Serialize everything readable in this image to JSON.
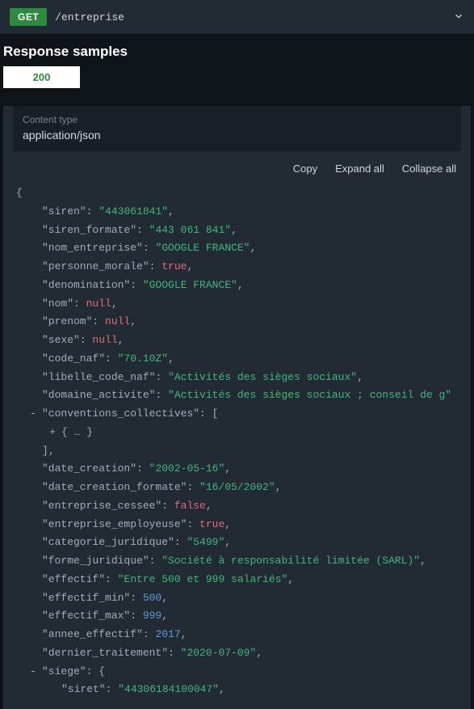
{
  "endpoint": {
    "method": "GET",
    "path": "/entreprise"
  },
  "section_title": "Response samples",
  "status_code": "200",
  "content_type_label": "Content type",
  "content_type_value": "application/json",
  "actions": {
    "copy": "Copy",
    "expand": "Expand all",
    "collapse": "Collapse all"
  },
  "collapsed_placeholder": "{ … }",
  "json_lines": [
    {
      "indent": 0,
      "type": "open",
      "text": "{"
    },
    {
      "indent": 1,
      "type": "kv",
      "key": "siren",
      "vtype": "s",
      "value": "443061841",
      "comma": true
    },
    {
      "indent": 1,
      "type": "kv",
      "key": "siren_formate",
      "vtype": "s",
      "value": "443 061 841",
      "comma": true
    },
    {
      "indent": 1,
      "type": "kv",
      "key": "nom_entreprise",
      "vtype": "s",
      "value": "GOOGLE FRANCE",
      "comma": true
    },
    {
      "indent": 1,
      "type": "kv",
      "key": "personne_morale",
      "vtype": "t",
      "value": "true",
      "comma": true
    },
    {
      "indent": 1,
      "type": "kv",
      "key": "denomination",
      "vtype": "s",
      "value": "GOOGLE FRANCE",
      "comma": true
    },
    {
      "indent": 1,
      "type": "kv",
      "key": "nom",
      "vtype": "nl",
      "value": "null",
      "comma": true
    },
    {
      "indent": 1,
      "type": "kv",
      "key": "prenom",
      "vtype": "nl",
      "value": "null",
      "comma": true
    },
    {
      "indent": 1,
      "type": "kv",
      "key": "sexe",
      "vtype": "nl",
      "value": "null",
      "comma": true
    },
    {
      "indent": 1,
      "type": "kv",
      "key": "code_naf",
      "vtype": "s",
      "value": "70.10Z",
      "comma": true
    },
    {
      "indent": 1,
      "type": "kv",
      "key": "libelle_code_naf",
      "vtype": "s",
      "value": "Activités des sièges sociaux",
      "comma": true
    },
    {
      "indent": 1,
      "type": "kv",
      "key": "domaine_activite",
      "vtype": "s",
      "value": "Activités des sièges sociaux ; conseil de g",
      "comma": false
    },
    {
      "indent": 1,
      "type": "key_open_arr",
      "toggle": "-",
      "key": "conventions_collectives"
    },
    {
      "indent": 2,
      "type": "collapsed",
      "toggle": "+"
    },
    {
      "indent": 1,
      "type": "close_arr",
      "comma": true
    },
    {
      "indent": 1,
      "type": "kv",
      "key": "date_creation",
      "vtype": "s",
      "value": "2002-05-16",
      "comma": true
    },
    {
      "indent": 1,
      "type": "kv",
      "key": "date_creation_formate",
      "vtype": "s",
      "value": "16/05/2002",
      "comma": true
    },
    {
      "indent": 1,
      "type": "kv",
      "key": "entreprise_cessee",
      "vtype": "f",
      "value": "false",
      "comma": true
    },
    {
      "indent": 1,
      "type": "kv",
      "key": "entreprise_employeuse",
      "vtype": "t",
      "value": "true",
      "comma": true
    },
    {
      "indent": 1,
      "type": "kv",
      "key": "categorie_juridique",
      "vtype": "s",
      "value": "5499",
      "comma": true
    },
    {
      "indent": 1,
      "type": "kv",
      "key": "forme_juridique",
      "vtype": "s",
      "value": "Société à responsabilité limitée (SARL)",
      "comma": true
    },
    {
      "indent": 1,
      "type": "kv",
      "key": "effectif",
      "vtype": "s",
      "value": "Entre 500 et 999 salariés",
      "comma": true
    },
    {
      "indent": 1,
      "type": "kv",
      "key": "effectif_min",
      "vtype": "n",
      "value": "500",
      "comma": true
    },
    {
      "indent": 1,
      "type": "kv",
      "key": "effectif_max",
      "vtype": "n",
      "value": "999",
      "comma": true
    },
    {
      "indent": 1,
      "type": "kv",
      "key": "annee_effectif",
      "vtype": "n",
      "value": "2017",
      "comma": true
    },
    {
      "indent": 1,
      "type": "kv",
      "key": "dernier_traitement",
      "vtype": "s",
      "value": "2020-07-09",
      "comma": true
    },
    {
      "indent": 1,
      "type": "key_open_obj",
      "toggle": "-",
      "key": "siege"
    },
    {
      "indent": 2,
      "type": "kv",
      "key": "siret",
      "vtype": "s",
      "value": "44306184100047",
      "comma": true
    }
  ]
}
